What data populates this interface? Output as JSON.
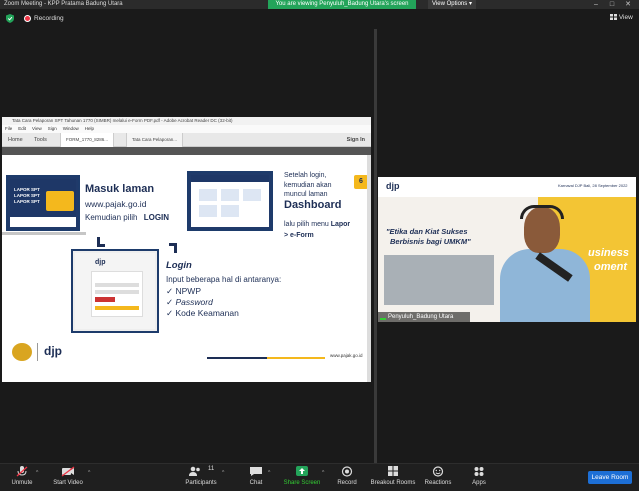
{
  "window": {
    "title": "Zoom Meeting - KPP Pratama Badung Utara",
    "viewing_banner": "You are viewing Penyuluh_Badung Utara's screen",
    "view_options": "View Options",
    "controls": [
      "–",
      "□",
      "✕"
    ]
  },
  "top": {
    "recording": "Recording",
    "view": "View"
  },
  "acrobat": {
    "title": "Tata Cara Pelaporan SPT Tahunan 1770 (SIMBR) melalui e-Form PDF.pdf - Adobe Acrobat Reader DC (32-bit)",
    "menu": [
      "File",
      "Edit",
      "View",
      "Sign",
      "Window",
      "Help"
    ],
    "tabs": {
      "home": "Home",
      "tools": "Tools",
      "doc1": "FORM_1770_8286...",
      "doc2": "Tata Cara Pelaporan...",
      "signin": "Sign In"
    }
  },
  "slide": {
    "step_number": "6",
    "masuk_title": "Masuk laman",
    "masuk_url": "www.pajak.go.id",
    "kemudian": "Kemudian pilih",
    "login_bold": "LOGIN",
    "laptop1_lines": [
      "LAPOR SPT",
      "LAPOR SPT",
      "LAPOR SPT"
    ],
    "setelah_lines": [
      "Setelah login,",
      "kemudian akan",
      "muncul laman"
    ],
    "dashboard": "Dashboard",
    "lalu_pilih": "lalu pilih menu",
    "lapor": "Lapor",
    "eform": "> e-Form",
    "login_title": "Login",
    "input_text": "Input beberapa hal di antaranya:",
    "checks": [
      "NPWP",
      "Password",
      "Kode Keamanan"
    ],
    "djp_small": "djp",
    "djp_footer": "djp",
    "footer_url": "www.pajak.go.id"
  },
  "video": {
    "header_right": "Karnaval DJP Bali, 28 September 2022",
    "djp": "djp",
    "quote_line1": "\"Etika dan Kiat Sukses",
    "quote_line2": "Berbisnis bagi UMKM\"",
    "bg_text1": "usiness",
    "bg_text2": "oment",
    "name": "Penyuluh_Badung Utara"
  },
  "toolbar": {
    "unmute": "Unmute",
    "start_video": "Start Video",
    "participants": "Participants",
    "participants_count": "11",
    "chat": "Chat",
    "share_screen": "Share Screen",
    "record": "Record",
    "breakout": "Breakout Rooms",
    "reactions": "Reactions",
    "apps": "Apps",
    "leave": "Leave Room"
  },
  "colors": {
    "share_green": "#23a45a",
    "leave_blue": "#1d6fd6",
    "navy": "#1d2e55",
    "accent_yellow": "#f4b81d"
  }
}
